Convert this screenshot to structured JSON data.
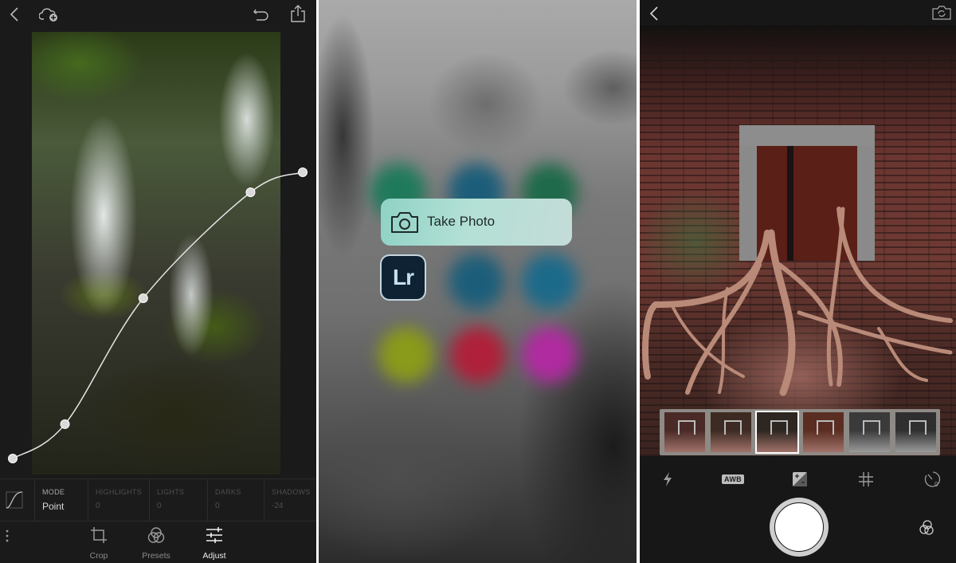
{
  "left_panel": {
    "app": "Lightroom editor - tone curve",
    "top_bar": {
      "back_icon": "chevron-left-icon",
      "cloud_icon": "cloud-add-icon",
      "undo_icon": "undo-icon",
      "share_icon": "share-icon"
    },
    "curve": {
      "description": "Tone curve overlay",
      "control_points": [
        {
          "input": 0.0,
          "output": 0.0
        },
        {
          "input": 0.18,
          "output": 0.12
        },
        {
          "input": 0.45,
          "output": 0.56
        },
        {
          "input": 0.82,
          "output": 0.93
        },
        {
          "input": 1.0,
          "output": 1.0
        }
      ],
      "color": "#e6e6e6"
    },
    "tone_tools": [
      {
        "label": "MODE",
        "value": "Point",
        "active": true
      },
      {
        "label": "HIGHLIGHTS",
        "value": "0",
        "active": false
      },
      {
        "label": "LIGHTS",
        "value": "0",
        "active": false
      },
      {
        "label": "DARKS",
        "value": "0",
        "active": false
      },
      {
        "label": "SHADOWS",
        "value": "-24",
        "active": false
      }
    ],
    "bottom_nav": [
      {
        "label": "Crop",
        "icon": "crop-icon",
        "active": false
      },
      {
        "label": "Presets",
        "icon": "presets-icon",
        "active": false
      },
      {
        "label": "Adjust",
        "icon": "adjust-sliders-icon",
        "active": true
      }
    ],
    "more_icon": "more-vertical-icon"
  },
  "middle_panel": {
    "quick_action": {
      "label": "Take Photo",
      "icon": "camera-icon"
    },
    "app_icon": {
      "label": "Lr",
      "bg_color": "#0e2233",
      "text_color": "#c4dff0"
    },
    "blurred_icon_colors": [
      "#1f7a5c",
      "#1c5e7a",
      "#1f6a4a",
      "#1c5e7a",
      "#1c6a8a",
      "#8a9a1a",
      "#b0203a",
      "#b02aa0"
    ]
  },
  "right_panel": {
    "top_bar": {
      "back_icon": "chevron-left-icon",
      "switch_camera_icon": "switch-camera-icon"
    },
    "filter_thumbnails": [
      {
        "name": "filter-1",
        "selected": false
      },
      {
        "name": "filter-2",
        "selected": false
      },
      {
        "name": "filter-3",
        "selected": true
      },
      {
        "name": "filter-4",
        "selected": false
      },
      {
        "name": "filter-5-bw",
        "selected": false
      },
      {
        "name": "filter-6-bw",
        "selected": false
      }
    ],
    "camera_controls": [
      {
        "name": "flash",
        "icon": "flash-icon"
      },
      {
        "name": "white-balance",
        "label": "AWB"
      },
      {
        "name": "exposure",
        "icon": "exposure-icon"
      },
      {
        "name": "grid",
        "icon": "grid-icon"
      },
      {
        "name": "timer",
        "icon": "timer-icon",
        "value": "0"
      }
    ],
    "shutter": "shutter-button",
    "presets_icon": "presets-icon"
  }
}
